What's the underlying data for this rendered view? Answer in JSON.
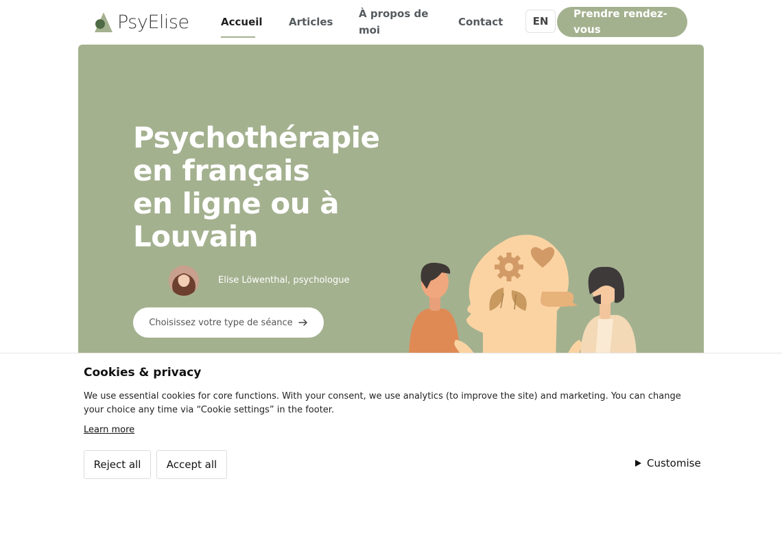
{
  "brand": {
    "name": "PsyElise",
    "accent_color": "#a4b18f"
  },
  "nav": {
    "items": [
      {
        "label": "Accueil",
        "active": true
      },
      {
        "label": "Articles",
        "active": false
      },
      {
        "label": "À propos de moi",
        "active": false
      },
      {
        "label": "Contact",
        "active": false
      }
    ],
    "lang": "EN",
    "cta": "Prendre rendez-vous"
  },
  "hero": {
    "title_lines": [
      "Psychothérapie",
      "en français",
      "en ligne ou à",
      "Louvain"
    ],
    "author": "Elise Löwenthal, psychologue",
    "session_button": "Choisissez votre type de séance",
    "session_button_icon": "arrow-right-icon"
  },
  "cookie": {
    "title": "Cookies & privacy",
    "text": "We use essential cookies for core functions. With your consent, we use analytics (to improve the site) and marketing. You can change your choice any time via “Cookie settings” in the footer.",
    "learn_more": "Learn more",
    "reject": "Reject all",
    "accept": "Accept all",
    "customise": "Customise"
  }
}
